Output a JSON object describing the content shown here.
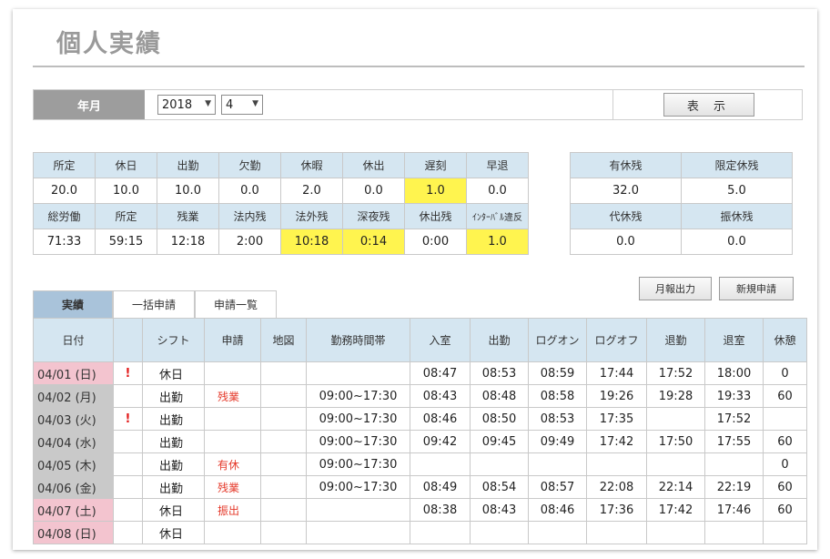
{
  "page_title": "個人実績",
  "month_bar": {
    "label": "年月",
    "year": "2018",
    "month": "4",
    "show_button": "表 示"
  },
  "summary": {
    "row1_headers": [
      "所定",
      "休日",
      "出勤",
      "欠勤",
      "休暇",
      "休出",
      "遅刻",
      "早退"
    ],
    "row1_values": [
      "20.0",
      "10.0",
      "10.0",
      "0.0",
      "2.0",
      "0.0",
      "1.0",
      "0.0"
    ],
    "row2_headers": [
      "総労働",
      "所定",
      "残業",
      "法内残",
      "法外残",
      "深夜残",
      "休出残",
      "ｲﾝﾀｰﾊﾞﾙ違反"
    ],
    "row2_values": [
      "71:33",
      "59:15",
      "12:18",
      "2:00",
      "10:18",
      "0:14",
      "0:00",
      "1.0"
    ]
  },
  "leave": {
    "row1_headers": [
      "有休残",
      "限定休残"
    ],
    "row1_values": [
      "32.0",
      "5.0"
    ],
    "row2_headers": [
      "代休残",
      "振休残"
    ],
    "row2_values": [
      "0.0",
      "0.0"
    ]
  },
  "actions": {
    "monthly_report": "月報出力",
    "new_request": "新規申請"
  },
  "tabs": [
    "実績",
    "一括申請",
    "申請一覧"
  ],
  "detail": {
    "headers": [
      "日付",
      "",
      "シフト",
      "申請",
      "地図",
      "勤務時間帯",
      "入室",
      "出勤",
      "ログオン",
      "ログオフ",
      "退勤",
      "退室",
      "休憩"
    ],
    "rows": [
      {
        "date": "04/01 (日)",
        "mark": "!",
        "shift": "休日",
        "req": "",
        "map": "",
        "hours": "",
        "in_room": "08:47",
        "clock_in": "08:53",
        "logon": "08:59",
        "logoff": "17:44",
        "clock_out": "17:52",
        "out_room": "18:00",
        "break": "0"
      },
      {
        "date": "04/02 (月)",
        "mark": "",
        "shift": "出勤",
        "req": "残業",
        "map": "",
        "hours": "09:00~17:30",
        "in_room": "08:43",
        "clock_in": "08:48",
        "logon": "08:58",
        "logoff": "19:26",
        "clock_out": "19:28",
        "out_room": "19:33",
        "break": "60"
      },
      {
        "date": "04/03 (火)",
        "mark": "!",
        "shift": "出勤",
        "req": "",
        "map": "",
        "hours": "09:00~17:30",
        "in_room": "08:46",
        "clock_in": "08:50",
        "logon": "08:53",
        "logoff": "17:35",
        "clock_out": "",
        "out_room": "17:52",
        "break": ""
      },
      {
        "date": "04/04 (水)",
        "mark": "",
        "shift": "出勤",
        "req": "",
        "map": "",
        "hours": "09:00~17:30",
        "in_room": "09:42",
        "clock_in": "09:45",
        "logon": "09:49",
        "logoff": "17:42",
        "clock_out": "17:50",
        "out_room": "17:55",
        "break": "60"
      },
      {
        "date": "04/05 (木)",
        "mark": "",
        "shift": "出勤",
        "req": "有休",
        "map": "",
        "hours": "09:00~17:30",
        "in_room": "",
        "clock_in": "",
        "logon": "",
        "logoff": "",
        "clock_out": "",
        "out_room": "",
        "break": "0"
      },
      {
        "date": "04/06 (金)",
        "mark": "",
        "shift": "出勤",
        "req": "残業",
        "map": "",
        "hours": "09:00~17:30",
        "in_room": "08:49",
        "clock_in": "08:54",
        "logon": "08:57",
        "logoff": "22:08",
        "clock_out": "22:14",
        "out_room": "22:19",
        "break": "60"
      },
      {
        "date": "04/07 (土)",
        "mark": "",
        "shift": "休日",
        "req": "振出",
        "map": "",
        "hours": "",
        "in_room": "08:38",
        "clock_in": "08:43",
        "logon": "08:46",
        "logoff": "17:36",
        "clock_out": "17:42",
        "out_room": "17:46",
        "break": "60"
      },
      {
        "date": "04/08 (日)",
        "mark": "",
        "shift": "休日",
        "req": "",
        "map": "",
        "hours": "",
        "in_room": "",
        "clock_in": "",
        "logon": "",
        "logoff": "",
        "clock_out": "",
        "out_room": "",
        "break": ""
      }
    ]
  },
  "colors": {
    "header_blue": "#d5e6f1",
    "active_tab": "#a9c3da",
    "highlight_yellow": "#fff44f",
    "holiday_pink": "#f3c4cf",
    "weekday_gray": "#c9c9c9",
    "alert_red": "#e21b1b"
  }
}
